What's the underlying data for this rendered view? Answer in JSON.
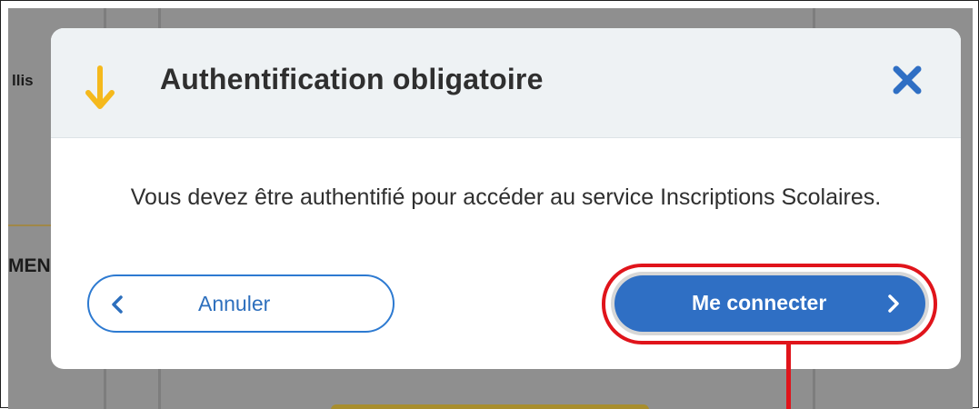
{
  "background": {
    "partial_text_left": "llis",
    "partial_text_left2": "MEN"
  },
  "dialog": {
    "title": "Authentification obligatoire",
    "header_icon": "arrow-down-icon",
    "close_icon": "close-icon",
    "message": "Vous devez être authentifié pour accéder au service Inscriptions Scolaires.",
    "cancel_label": "Annuler",
    "connect_label": "Me connecter"
  },
  "colors": {
    "accent_blue": "#2f6fc4",
    "arrow_yellow": "#f5b91c",
    "highlight_red": "#e0141b"
  }
}
